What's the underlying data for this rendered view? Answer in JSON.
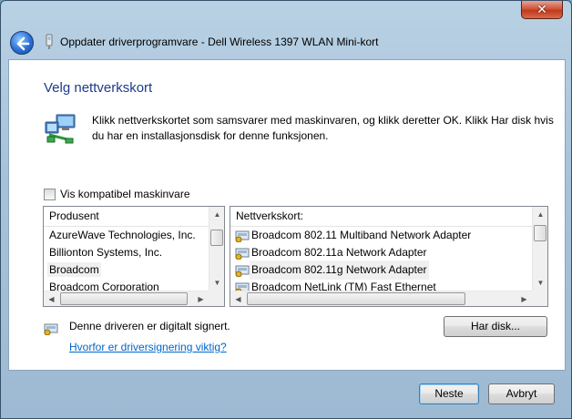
{
  "window": {
    "title": "Oppdater driverprogramvare - Dell Wireless 1397 WLAN Mini-kort",
    "close_label": "✕"
  },
  "page": {
    "heading": "Velg nettverkskort",
    "description": "Klikk nettverkskortet som samsvarer med maskinvaren, og klikk deretter OK. Klikk Har disk hvis du har en installasjonsdisk for denne funksjonen."
  },
  "compatible": {
    "label": "Vis kompatibel maskinvare",
    "checked": false
  },
  "manufacturers": {
    "header": "Produsent",
    "items": [
      "AzureWave Technologies, Inc.",
      "Billionton Systems, Inc.",
      "Broadcom",
      "Broadcom Corporation"
    ],
    "selected": "Broadcom"
  },
  "adapters": {
    "header": "Nettverkskort:",
    "items": [
      "Broadcom 802.11 Multiband Network Adapter",
      "Broadcom 802.11a Network Adapter",
      "Broadcom 802.11g Network Adapter",
      "Broadcom NetLink (TM) Fast Ethernet"
    ],
    "selected": "Broadcom 802.11g Network Adapter"
  },
  "signature": {
    "text": "Denne driveren er digitalt signert.",
    "link": "Hvorfor er driversignering viktig?"
  },
  "buttons": {
    "have_disk": "Har disk...",
    "next": "Neste",
    "cancel": "Avbryt"
  },
  "colors": {
    "heading": "#1e3b8c",
    "link": "#0066cc",
    "default_button_border": "#3c7fb1"
  }
}
